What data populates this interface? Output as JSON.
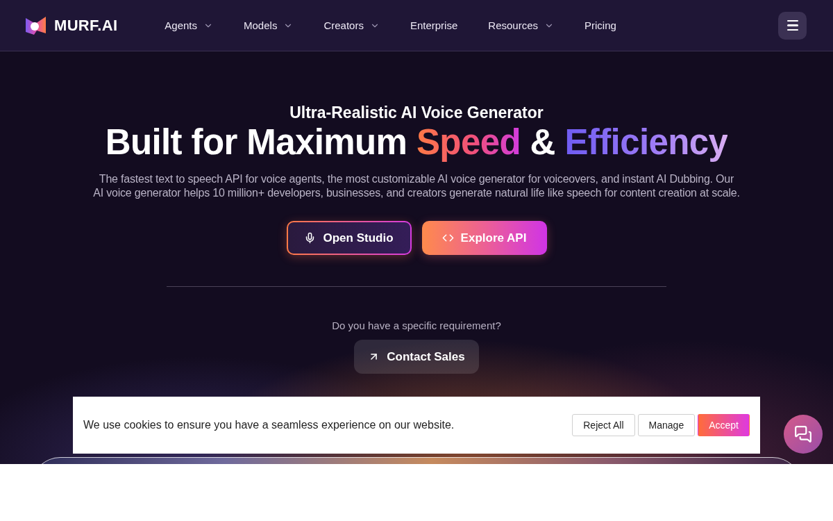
{
  "header": {
    "logo": "MURF.AI",
    "nav": [
      {
        "label": "Agents",
        "kind": "dropdown"
      },
      {
        "label": "Models",
        "kind": "dropdown"
      },
      {
        "label": "Creators",
        "kind": "dropdown"
      },
      {
        "label": "Enterprise",
        "kind": "link"
      },
      {
        "label": "Resources",
        "kind": "dropdown"
      },
      {
        "label": "Pricing",
        "kind": "link"
      }
    ]
  },
  "hero": {
    "eyebrow": "Ultra-Realistic AI Voice Generator",
    "title": [
      {
        "text": "Built for Maximum",
        "kind": "plain"
      },
      {
        "text": "Speed",
        "kind": "warm"
      },
      {
        "text": "&",
        "kind": "plain"
      },
      {
        "text": "Efficiency",
        "kind": "cool"
      }
    ],
    "description_lines": [
      "The fastest text to speech API for voice agents, the most customizable AI voice generator for voiceovers, and instant AI Dubbing. Our",
      "AI voice generator helps 10 million+ developers, businesses, and creators generate natural life like speech for content creation at scale."
    ],
    "buttons": [
      {
        "label": "Open Studio",
        "kind": "outline"
      },
      {
        "label": "Explore API",
        "kind": "gradient"
      }
    ],
    "requirement": {
      "prompt": "Do you have a specific requirement?",
      "button": "Contact Sales"
    }
  },
  "cookie_banner": {
    "message": "We use cookies to ensure you have a seamless experience on our website.",
    "buttons": [
      {
        "label": "Reject All",
        "kind": "plain"
      },
      {
        "label": "Manage",
        "kind": "plain"
      },
      {
        "label": "Accept",
        "kind": "primary"
      }
    ]
  }
}
